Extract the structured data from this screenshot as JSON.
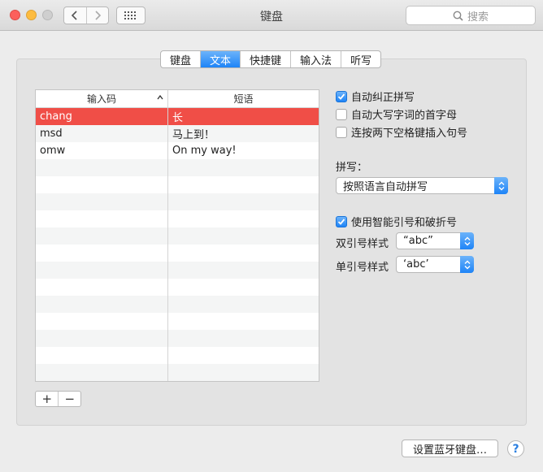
{
  "window": {
    "title": "键盘",
    "search_placeholder": "搜索"
  },
  "tabs": [
    {
      "label": "键盘",
      "active": false
    },
    {
      "label": "文本",
      "active": true
    },
    {
      "label": "快捷键",
      "active": false
    },
    {
      "label": "输入法",
      "active": false
    },
    {
      "label": "听写",
      "active": false
    }
  ],
  "table": {
    "columns": [
      "输入码",
      "短语"
    ],
    "rows": [
      {
        "code": "chang",
        "phrase": "长",
        "selected": true
      },
      {
        "code": "msd",
        "phrase": "马上到！",
        "selected": false
      },
      {
        "code": "omw",
        "phrase": "On my way!",
        "selected": false
      }
    ]
  },
  "table_buttons": {
    "add": "+",
    "remove": "−"
  },
  "options": {
    "auto_correct": {
      "label": "自动纠正拼写",
      "checked": true
    },
    "auto_capitalize": {
      "label": "自动大写字词的首字母",
      "checked": false
    },
    "double_space_period": {
      "label": "连按两下空格键插入句号",
      "checked": false
    },
    "spelling_label": "拼写：",
    "spelling_value": "按照语言自动拼写",
    "smart_quotes": {
      "label": "使用智能引号和破折号",
      "checked": true
    },
    "double_quote_label": "双引号样式",
    "double_quote_value": "“abc”",
    "single_quote_label": "单引号样式",
    "single_quote_value": "‘abc’"
  },
  "footer": {
    "bluetooth_button": "设置蓝牙键盘…",
    "help": "?"
  },
  "colors": {
    "accent": "#1e84f7",
    "selection": "#f04e47"
  }
}
